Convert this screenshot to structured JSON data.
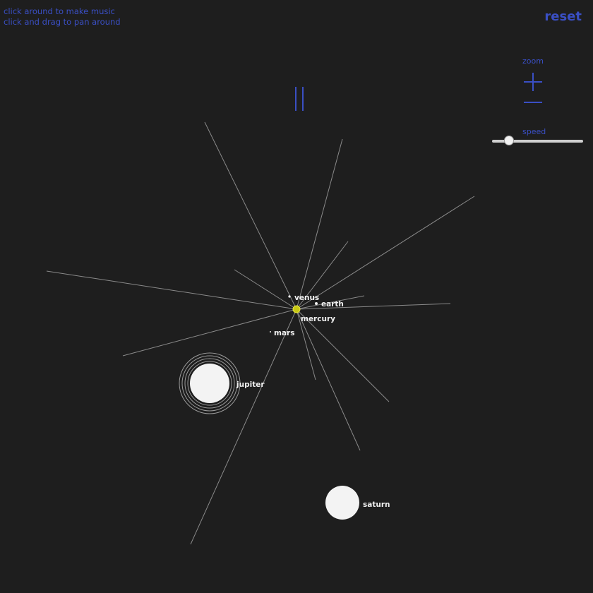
{
  "help": {
    "line1": "click around to make music",
    "line2": "click and drag to pan around"
  },
  "controls": {
    "reset_label": "reset",
    "zoom_label": "zoom",
    "speed_label": "speed",
    "speed_value": 0.15,
    "accent_color": "#3a4fc4",
    "play_state": "playing"
  },
  "scene": {
    "background_color": "#1e1e1e",
    "sun_color": "#c8c814",
    "planets": [
      {
        "name": "mercury",
        "label": "mercury"
      },
      {
        "name": "venus",
        "label": "venus"
      },
      {
        "name": "earth",
        "label": "earth"
      },
      {
        "name": "mars",
        "label": "mars"
      },
      {
        "name": "jupiter",
        "label": "jupiter"
      },
      {
        "name": "saturn",
        "label": "saturn"
      }
    ]
  }
}
